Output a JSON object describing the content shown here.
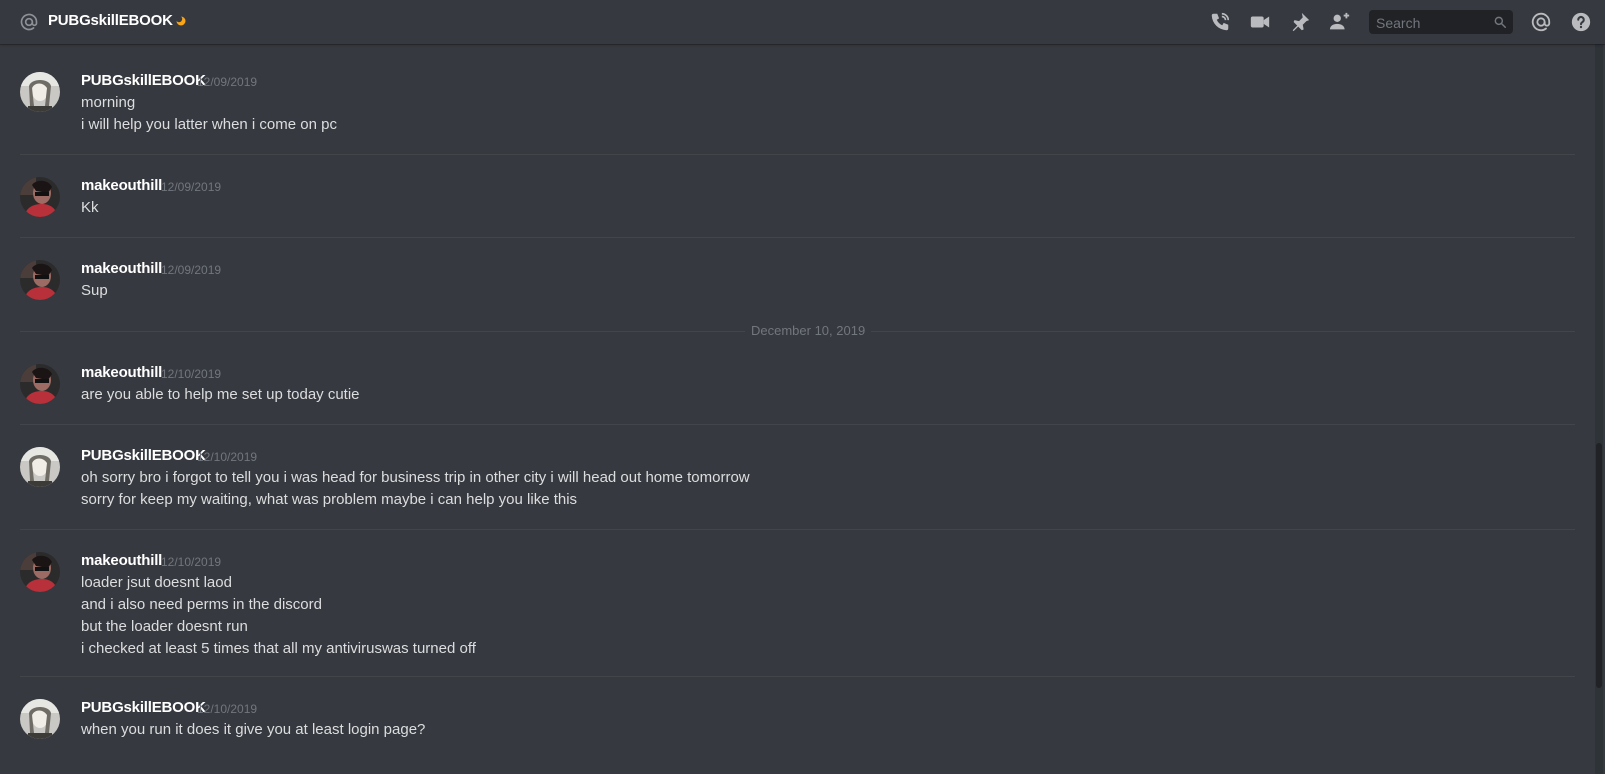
{
  "header": {
    "channel_name": "PUBGskillEBOOK",
    "search_placeholder": "Search",
    "icons": [
      "at-icon",
      "moon-status-icon",
      "phone-call-icon",
      "video-call-icon",
      "pin-icon",
      "add-friend-icon",
      "search-icon",
      "mentions-icon",
      "help-icon"
    ]
  },
  "colors": {
    "background": "#36393f",
    "header_text": "#ffffff",
    "timestamp": "#72767d",
    "message_text": "#dcddde",
    "search_bg": "#202225",
    "idle_status": "#faa61a"
  },
  "date_divider": "December 10, 2019",
  "messages": [
    {
      "author": "PUBGskillEBOOK",
      "timestamp": "12/09/2019",
      "avatar": "pubg-avatar",
      "lines": [
        "morning",
        "i will help you latter when i come on pc"
      ]
    },
    {
      "author": "makeouthill",
      "timestamp": "12/09/2019",
      "avatar": "makeouthill-avatar",
      "lines": [
        "Kk"
      ]
    },
    {
      "author": "makeouthill",
      "timestamp": "12/09/2019",
      "avatar": "makeouthill-avatar",
      "lines": [
        "Sup"
      ]
    },
    {
      "author": "makeouthill",
      "timestamp": "12/10/2019",
      "avatar": "makeouthill-avatar",
      "lines": [
        "are you able to help me set up today cutie"
      ]
    },
    {
      "author": "PUBGskillEBOOK",
      "timestamp": "12/10/2019",
      "avatar": "pubg-avatar",
      "lines": [
        "oh sorry bro i forgot to tell you i was head for business trip in other city i will head out home tomorrow",
        "sorry for keep my waiting, what was problem maybe i can help you like this"
      ]
    },
    {
      "author": "makeouthill",
      "timestamp": "12/10/2019",
      "avatar": "makeouthill-avatar",
      "lines": [
        "loader jsut doesnt laod",
        "and i also need perms in the discord",
        "but the loader doesnt run",
        "i checked at least 5 times that all my antiviruswas turned off"
      ]
    },
    {
      "author": "PUBGskillEBOOK",
      "timestamp": "12/10/2019",
      "avatar": "pubg-avatar",
      "lines": [
        "when you run it does it give you at least login page?"
      ]
    }
  ]
}
